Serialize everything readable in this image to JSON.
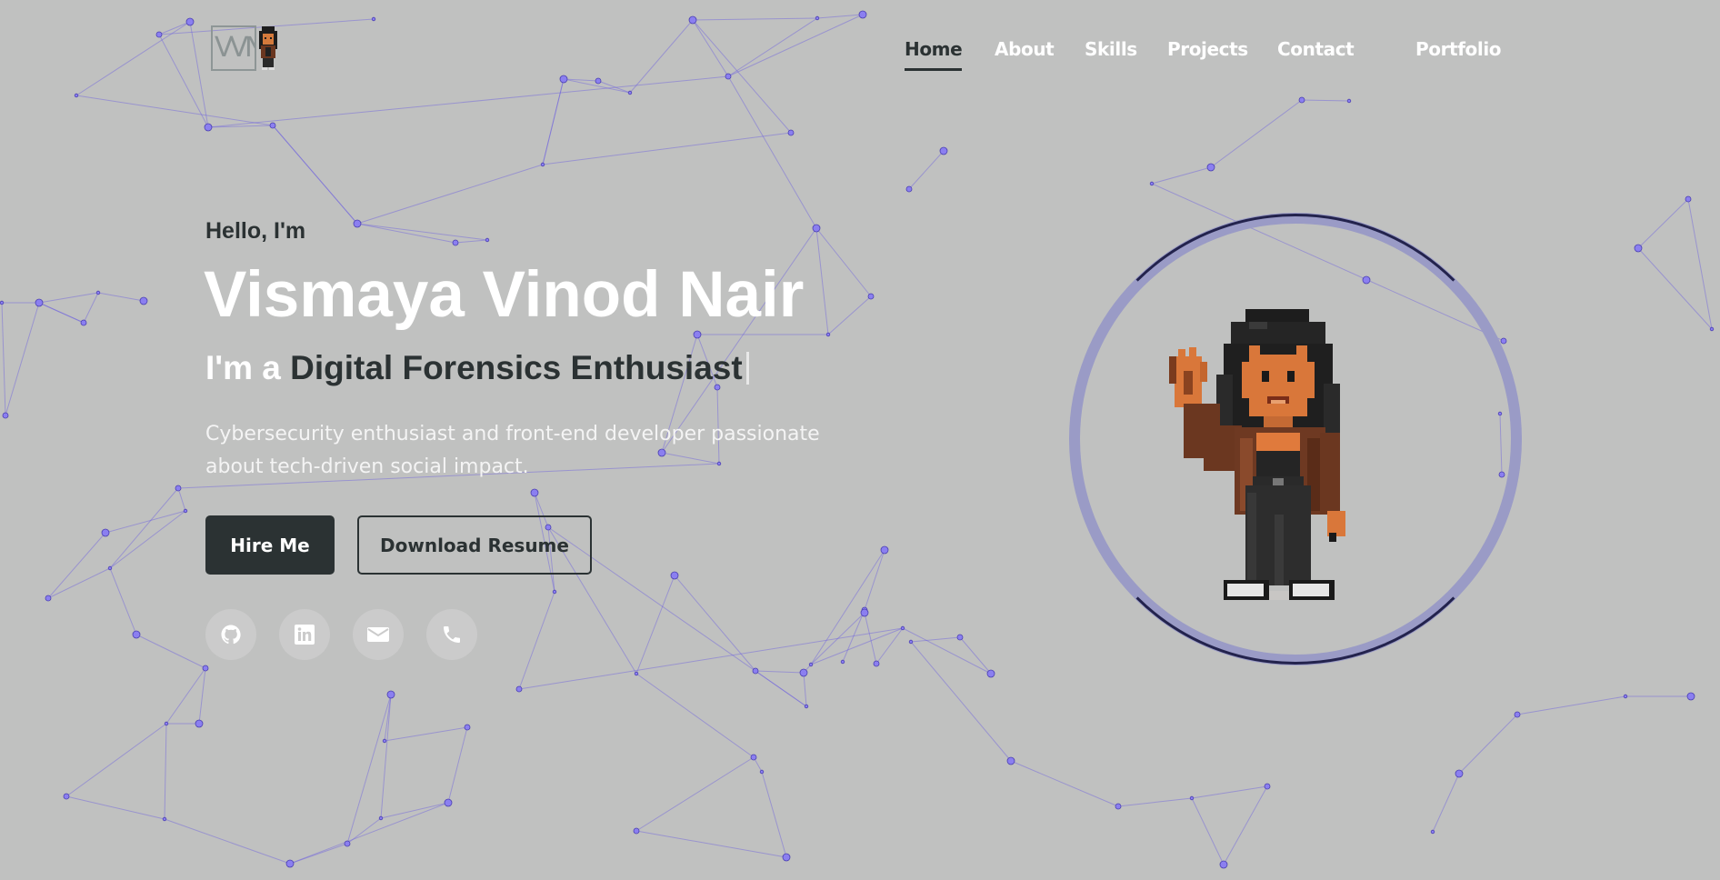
{
  "logo": {
    "text": "VVN"
  },
  "nav": [
    {
      "label": "Home",
      "active": true
    },
    {
      "label": "About",
      "active": false
    },
    {
      "label": "Skills",
      "active": false
    },
    {
      "label": "Projects",
      "active": false
    },
    {
      "label": "Contact",
      "active": false
    },
    {
      "label": "Portfolio",
      "active": false
    }
  ],
  "hero": {
    "greeting": "Hello, I'm",
    "name": "Vismaya Vinod Nair",
    "role_prefix": "I'm a",
    "role_typed": "Digital Forensics Enthusiast",
    "description": "Cybersecurity enthusiast and front-end developer passionate about tech-driven social impact.",
    "hire_label": "Hire Me",
    "resume_label": "Download Resume"
  },
  "social": [
    {
      "icon": "github-icon"
    },
    {
      "icon": "linkedin-icon"
    },
    {
      "icon": "email-icon"
    },
    {
      "icon": "phone-icon"
    }
  ],
  "colors": {
    "background": "#c0c1c0",
    "dark": "#2b3233",
    "accent_ring": "#9a9bc6",
    "ring_outline": "#23234d",
    "network": "#6a5ee0"
  }
}
